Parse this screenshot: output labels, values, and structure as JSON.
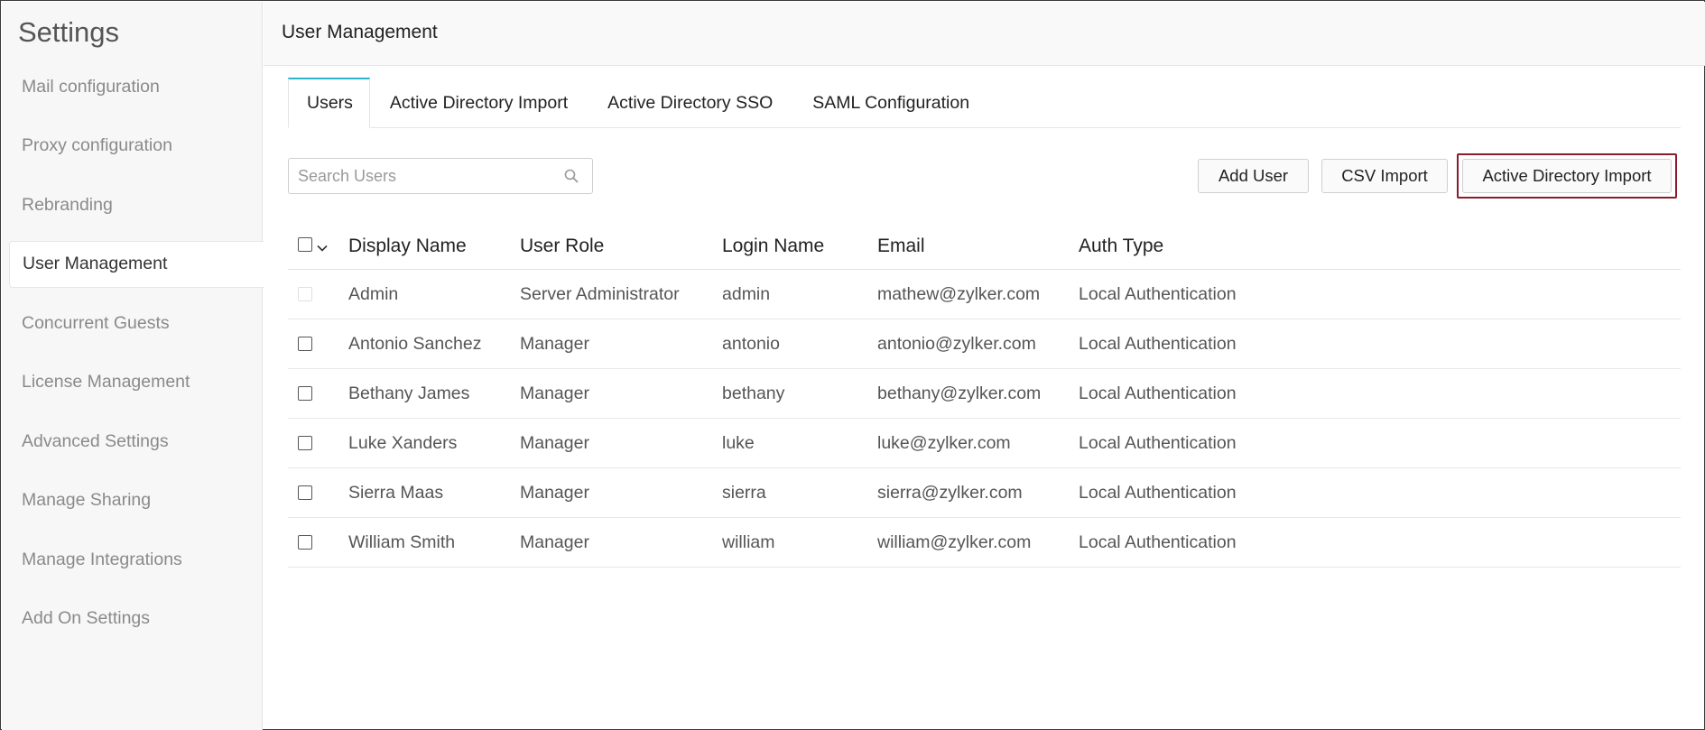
{
  "sidebar": {
    "title": "Settings",
    "items": [
      {
        "label": "Mail configuration",
        "active": false
      },
      {
        "label": "Proxy configuration",
        "active": false
      },
      {
        "label": "Rebranding",
        "active": false
      },
      {
        "label": "User Management",
        "active": true
      },
      {
        "label": "Concurrent Guests",
        "active": false
      },
      {
        "label": "License Management",
        "active": false
      },
      {
        "label": "Advanced Settings",
        "active": false
      },
      {
        "label": "Manage Sharing",
        "active": false
      },
      {
        "label": "Manage Integrations",
        "active": false
      },
      {
        "label": "Add On Settings",
        "active": false
      }
    ]
  },
  "header": {
    "title": "User Management"
  },
  "tabs": [
    {
      "label": "Users",
      "active": true
    },
    {
      "label": "Active Directory Import",
      "active": false
    },
    {
      "label": "Active Directory SSO",
      "active": false
    },
    {
      "label": "SAML Configuration",
      "active": false
    }
  ],
  "search": {
    "placeholder": "Search Users",
    "value": ""
  },
  "toolbar": {
    "add_user_label": "Add User",
    "csv_import_label": "CSV Import",
    "ad_import_label": "Active Directory Import",
    "highlight_color": "#8b1a2b"
  },
  "table": {
    "columns": [
      "Display Name",
      "User Role",
      "Login Name",
      "Email",
      "Auth Type"
    ],
    "rows": [
      {
        "display_name": "Admin",
        "role": "Server Administrator",
        "login": "admin",
        "email": "mathew@zylker.com",
        "auth": "Local Authentication",
        "checkbox_disabled": true
      },
      {
        "display_name": "Antonio Sanchez",
        "role": "Manager",
        "login": "antonio",
        "email": "antonio@zylker.com",
        "auth": "Local Authentication",
        "checkbox_disabled": false
      },
      {
        "display_name": "Bethany James",
        "role": "Manager",
        "login": "bethany",
        "email": "bethany@zylker.com",
        "auth": "Local Authentication",
        "checkbox_disabled": false
      },
      {
        "display_name": "Luke Xanders",
        "role": "Manager",
        "login": "luke",
        "email": "luke@zylker.com",
        "auth": "Local Authentication",
        "checkbox_disabled": false
      },
      {
        "display_name": "Sierra Maas",
        "role": "Manager",
        "login": "sierra",
        "email": "sierra@zylker.com",
        "auth": "Local Authentication",
        "checkbox_disabled": false
      },
      {
        "display_name": "William Smith",
        "role": "Manager",
        "login": "william",
        "email": "william@zylker.com",
        "auth": "Local Authentication",
        "checkbox_disabled": false
      }
    ]
  },
  "colors": {
    "tab_accent": "#2bb5c8",
    "sidebar_bg": "#f7f7f7"
  }
}
